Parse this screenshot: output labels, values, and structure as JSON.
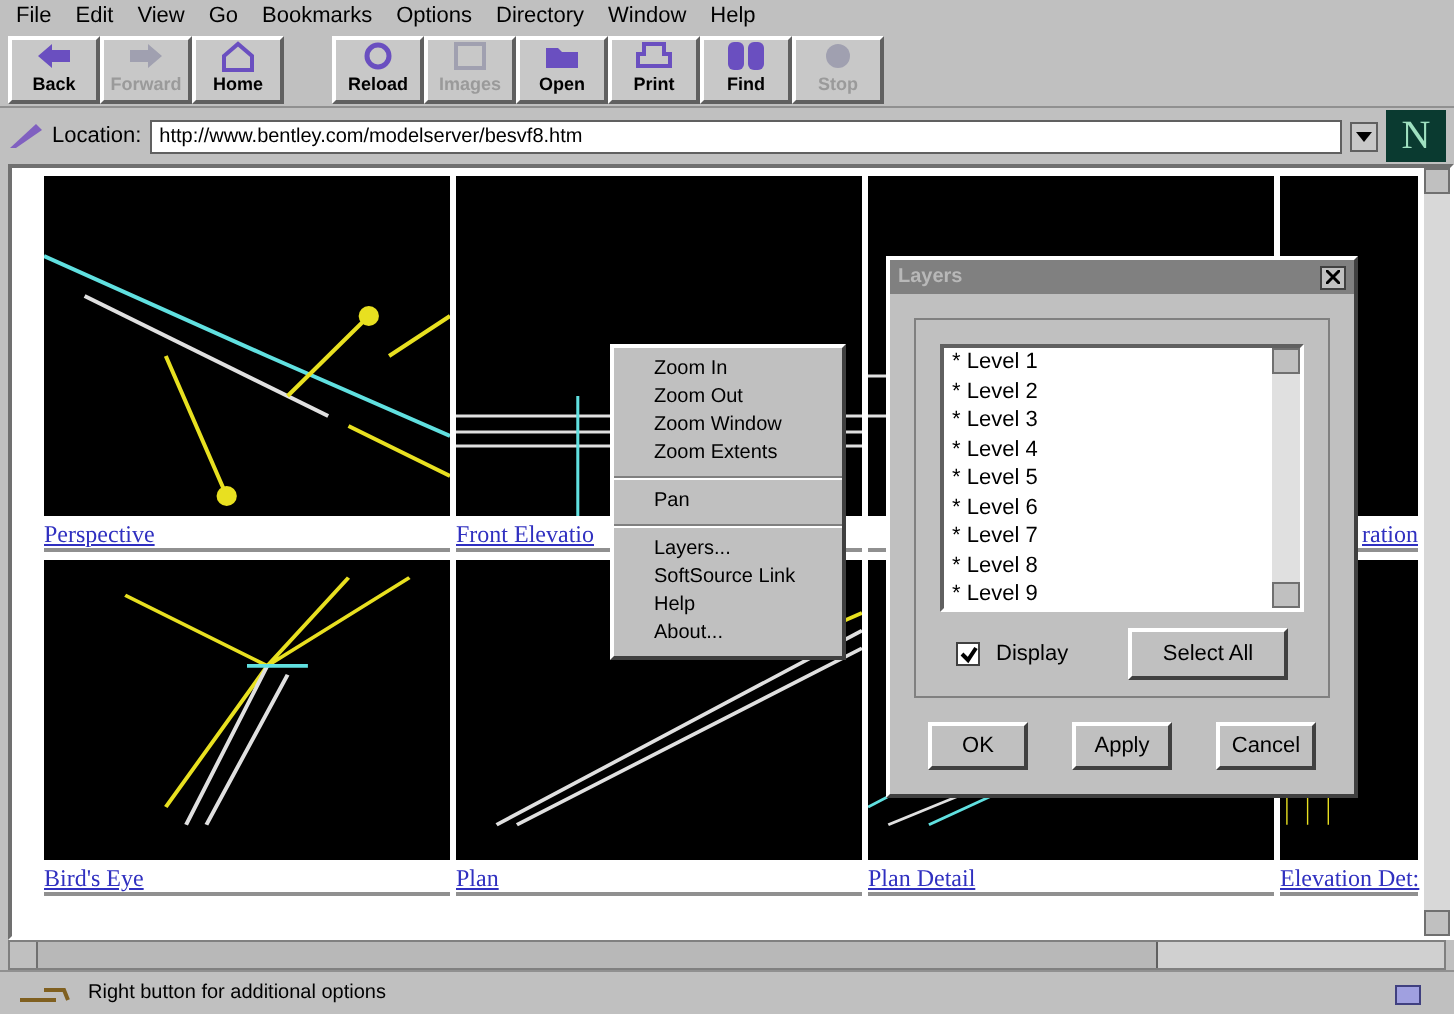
{
  "menu_bar": [
    "File",
    "Edit",
    "View",
    "Go",
    "Bookmarks",
    "Options",
    "Directory",
    "Window",
    "Help"
  ],
  "toolbar": [
    {
      "label": "Back",
      "kind": "back",
      "disabled": false
    },
    {
      "label": "Forward",
      "kind": "forward",
      "disabled": true
    },
    {
      "label": "Home",
      "kind": "home",
      "disabled": false
    },
    {
      "label": "Reload",
      "kind": "reload",
      "disabled": false
    },
    {
      "label": "Images",
      "kind": "images",
      "disabled": true
    },
    {
      "label": "Open",
      "kind": "open",
      "disabled": false
    },
    {
      "label": "Print",
      "kind": "print",
      "disabled": false
    },
    {
      "label": "Find",
      "kind": "find",
      "disabled": false
    },
    {
      "label": "Stop",
      "kind": "stop",
      "disabled": true
    }
  ],
  "location": {
    "label": "Location:",
    "url": "http://www.bentley.com/modelserver/besvf8.htm"
  },
  "logo": "N",
  "views": [
    {
      "label": "Perspective",
      "kind": "perspective"
    },
    {
      "label": "Front Elevatio",
      "kind": "front"
    },
    {
      "kind": "side"
    },
    {
      "label": "ration",
      "kind": "elevation"
    },
    {
      "label": "Bird's Eye",
      "kind": "birds"
    },
    {
      "label": "Plan",
      "kind": "plan"
    },
    {
      "label": "Plan Detail",
      "kind": "detail"
    },
    {
      "label": "Elevation Det:",
      "kind": "elevdet"
    }
  ],
  "context_menu": [
    {
      "label": "Zoom In",
      "kind": "item"
    },
    {
      "label": "Zoom Out",
      "kind": "item"
    },
    {
      "label": "Zoom Window",
      "kind": "item"
    },
    {
      "label": "Zoom Extents",
      "kind": "item"
    },
    {
      "kind": "separator"
    },
    {
      "label": "Pan",
      "kind": "item"
    },
    {
      "kind": "separator"
    },
    {
      "label": "Layers...",
      "kind": "item"
    },
    {
      "label": "SoftSource Link",
      "kind": "item"
    },
    {
      "label": "Help",
      "kind": "item"
    },
    {
      "label": "About...",
      "kind": "item"
    }
  ],
  "dialog": {
    "title": "Layers",
    "levels": [
      "* Level 1",
      "* Level 2",
      "* Level 3",
      "* Level 4",
      "* Level 5",
      "* Level 6",
      "* Level 7",
      "* Level 8",
      "* Level 9"
    ],
    "display": {
      "label": "Display",
      "checked": true
    },
    "select_all": "Select All",
    "buttons": [
      "OK",
      "Apply",
      "Cancel"
    ]
  },
  "status_bar": {
    "text": "Right button for additional options"
  }
}
